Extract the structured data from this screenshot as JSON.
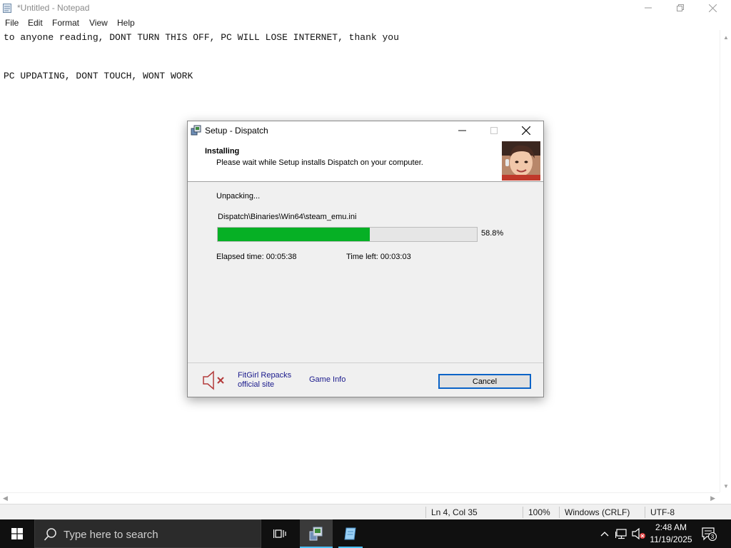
{
  "notepad": {
    "title": "*Untitled - Notepad",
    "menu": [
      "File",
      "Edit",
      "Format",
      "View",
      "Help"
    ],
    "lines": [
      "to anyone reading, DONT TURN THIS OFF, PC WILL LOSE INTERNET, thank you",
      "",
      "PC UPDATING, DONT TOUCH, WONT WORK"
    ],
    "status": {
      "position": "Ln 4, Col 35",
      "zoom": "100%",
      "line_ending": "Windows (CRLF)",
      "encoding": "UTF-8"
    }
  },
  "setup": {
    "title": "Setup - Dispatch",
    "heading": "Installing",
    "subheading": "Please wait while Setup installs Dispatch on your computer.",
    "status": "Unpacking...",
    "current_file": "Dispatch\\Binaries\\Win64\\steam_emu.ini",
    "progress_percent": 58.8,
    "progress_label": "58.8%",
    "elapsed": "Elapsed time:  00:05:38",
    "time_left": "Time left:  00:03:03",
    "link_site_line1": "FitGirl Repacks",
    "link_site_line2": "official site",
    "link_game_info": "Game Info",
    "cancel_label": "Cancel",
    "progress_color": "#06b025"
  },
  "taskbar": {
    "search_placeholder": "Type here to search",
    "time": "2:48 AM",
    "date": "11/19/2025",
    "notification_count": "3",
    "accent_color": "#4cc2ff"
  }
}
